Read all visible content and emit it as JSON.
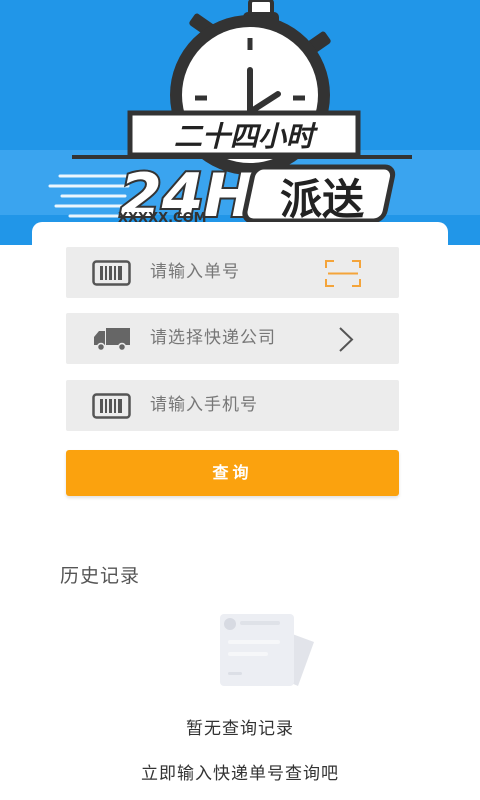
{
  "banner": {
    "title_cn": "二十四小时",
    "logo_24h": "24H",
    "logo_cn": "派送",
    "domain": "XXXXX.COM"
  },
  "form": {
    "tracking_placeholder": "请输入单号",
    "company_placeholder": "请选择快递公司",
    "phone_placeholder": "请输入手机号",
    "query_label": "查询"
  },
  "history": {
    "title": "历史记录",
    "empty_title": "暂无查询记录",
    "empty_subtitle": "立即输入快递单号查询吧"
  },
  "colors": {
    "banner_blue": "#2196e8",
    "accent_orange": "#fba20e",
    "field_bg": "#ececec"
  },
  "icons": {
    "tracking": "barcode-icon",
    "scan": "scan-icon",
    "company": "truck-icon",
    "chevron": "chevron-right-icon",
    "phone": "barcode-icon"
  }
}
